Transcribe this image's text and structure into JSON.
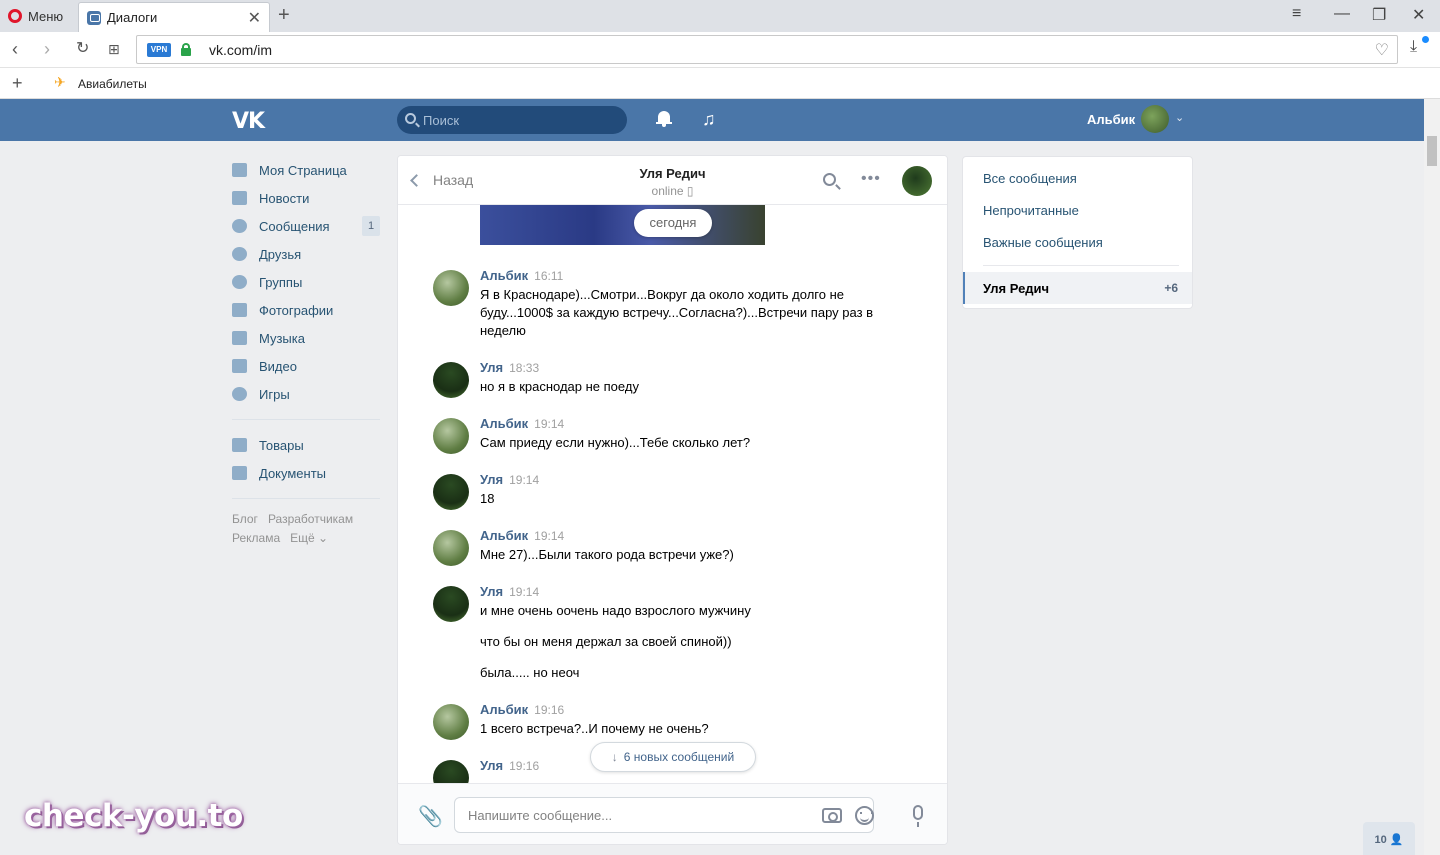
{
  "browser": {
    "menu_label": "Меню",
    "tab_title": "Диалоги",
    "tab_close": "✕",
    "new_tab": "+",
    "url": "vk.com/im",
    "vpn_badge": "VPN",
    "bookmark_label": "Авиабилеты"
  },
  "header": {
    "logo": "VK",
    "search_placeholder": "Поиск",
    "user_name": "Альбик"
  },
  "sidenav": {
    "items": [
      {
        "label": "Моя Страница"
      },
      {
        "label": "Новости"
      },
      {
        "label": "Сообщения",
        "count": "1"
      },
      {
        "label": "Друзья"
      },
      {
        "label": "Группы"
      },
      {
        "label": "Фотографии"
      },
      {
        "label": "Музыка"
      },
      {
        "label": "Видео"
      },
      {
        "label": "Игры"
      }
    ],
    "items2": [
      {
        "label": "Товары"
      },
      {
        "label": "Документы"
      }
    ],
    "footer": [
      "Блог",
      "Разработчикам",
      "Реклама",
      "Ещё ⌄"
    ]
  },
  "chat": {
    "back_label": "Назад",
    "peer_name": "Уля Редич",
    "peer_status": "online ▯",
    "today_label": "сегодня",
    "messages": [
      {
        "author": "Альбик",
        "time": "16:11",
        "lines": [
          "Я в Краснодаре)...Смотри...Вокруг да около ходить долго не буду...1000$ за каждую встречу...Согласна?)...Встречи пару раз в неделю"
        ]
      },
      {
        "author": "Уля",
        "time": "18:33",
        "lines": [
          "но я в краснодар не поеду"
        ]
      },
      {
        "author": "Альбик",
        "time": "19:14",
        "lines": [
          "Сам приеду если нужно)...Тебе сколько лет?"
        ]
      },
      {
        "author": "Уля",
        "time": "19:14",
        "lines": [
          "18"
        ]
      },
      {
        "author": "Альбик",
        "time": "19:14",
        "lines": [
          "Мне 27)...Были такого рода встречи уже?)"
        ]
      },
      {
        "author": "Уля",
        "time": "19:14",
        "lines": [
          "и мне очень оочень надо взрослого мужчину",
          "что бы он меня держал за своей спиной))",
          "была..... но неоч"
        ]
      },
      {
        "author": "Альбик",
        "time": "19:16",
        "lines": [
          "1 всего встреча?..И почему не очень?"
        ]
      },
      {
        "author": "Уля",
        "time": "19:16",
        "lines": [
          ""
        ]
      }
    ],
    "new_messages_label": "6 новых сообщений",
    "composer_placeholder": "Напишите сообщение..."
  },
  "rightpanel": {
    "items": [
      "Все сообщения",
      "Непрочитанные",
      "Важные сообщения"
    ],
    "active_name": "Уля Редич",
    "active_count": "+6"
  },
  "online_count": "10 👤",
  "watermark": "check-you.to",
  "colors": {
    "vk_blue": "#4a76a8",
    "link": "#285473",
    "author": "#42648b"
  }
}
